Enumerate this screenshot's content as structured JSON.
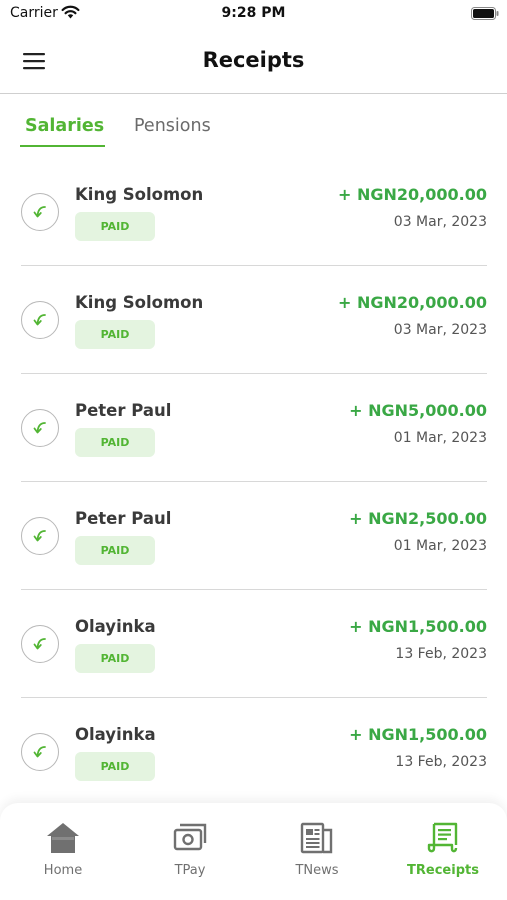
{
  "status_bar": {
    "carrier": "Carrier",
    "time": "9:28 PM"
  },
  "header": {
    "title": "Receipts"
  },
  "tabs": [
    {
      "label": "Salaries",
      "active": true
    },
    {
      "label": "Pensions",
      "active": false
    }
  ],
  "receipts": [
    {
      "name": "King Solomon",
      "status": "PAID",
      "amount": "+ NGN20,000.00",
      "date": "03 Mar, 2023"
    },
    {
      "name": "King Solomon",
      "status": "PAID",
      "amount": "+ NGN20,000.00",
      "date": "03 Mar, 2023"
    },
    {
      "name": "Peter Paul",
      "status": "PAID",
      "amount": "+ NGN5,000.00",
      "date": "01 Mar, 2023"
    },
    {
      "name": "Peter Paul",
      "status": "PAID",
      "amount": "+ NGN2,500.00",
      "date": "01 Mar, 2023"
    },
    {
      "name": "Olayinka",
      "status": "PAID",
      "amount": "+ NGN1,500.00",
      "date": "13 Feb, 2023"
    },
    {
      "name": "Olayinka",
      "status": "PAID",
      "amount": "+ NGN1,500.00",
      "date": "13 Feb, 2023"
    }
  ],
  "tabbar": {
    "items": [
      {
        "label": "Home",
        "icon": "home-icon",
        "active": false
      },
      {
        "label": "TPay",
        "icon": "cash-icon",
        "active": false
      },
      {
        "label": "TNews",
        "icon": "newspaper-icon",
        "active": false
      },
      {
        "label": "TReceipts",
        "icon": "receipt-icon",
        "active": true
      }
    ]
  },
  "colors": {
    "accent": "#52b534",
    "amount": "#3aa845",
    "badge_bg": "#e4f4e0"
  }
}
